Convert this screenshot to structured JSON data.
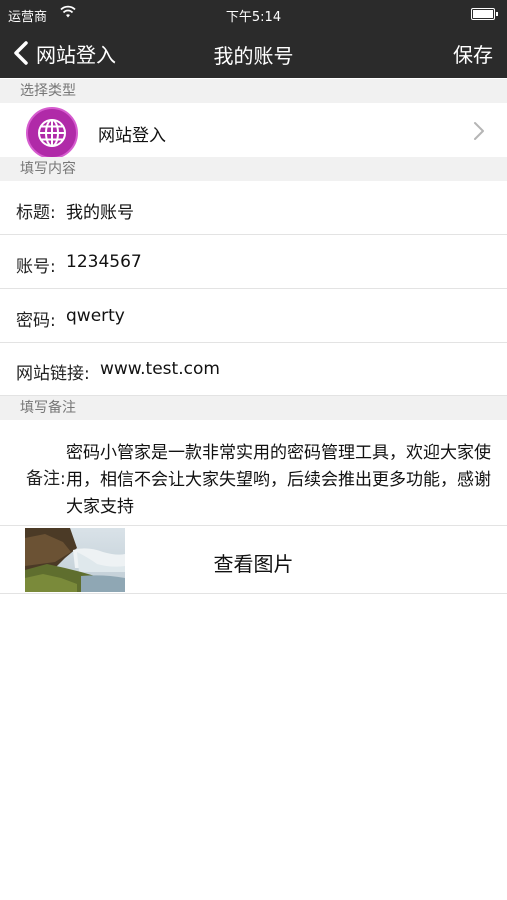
{
  "status_bar": {
    "carrier": "运营商",
    "time": "下午5:14"
  },
  "nav": {
    "back_label": "网站登入",
    "title": "我的账号",
    "save_label": "保存"
  },
  "sections": {
    "type": "选择类型",
    "content": "填写内容",
    "notes": "填写备注"
  },
  "type_row": {
    "label": "网站登入",
    "icon": "globe-icon",
    "icon_color": "#b02aa8"
  },
  "fields": [
    {
      "label": "标题:",
      "value": "我的账号"
    },
    {
      "label": "账号:",
      "value": "1234567"
    },
    {
      "label": "密码:",
      "value": "qwerty"
    },
    {
      "label": "网站链接:",
      "value": "www.test.com"
    }
  ],
  "note": {
    "label": "备注:",
    "text": "密码小管家是一款非常实用的密码管理工具，欢迎大家使用，相信不会让大家失望哟，后续会推出更多功能，感谢大家支持"
  },
  "image_row": {
    "label": "查看图片"
  }
}
